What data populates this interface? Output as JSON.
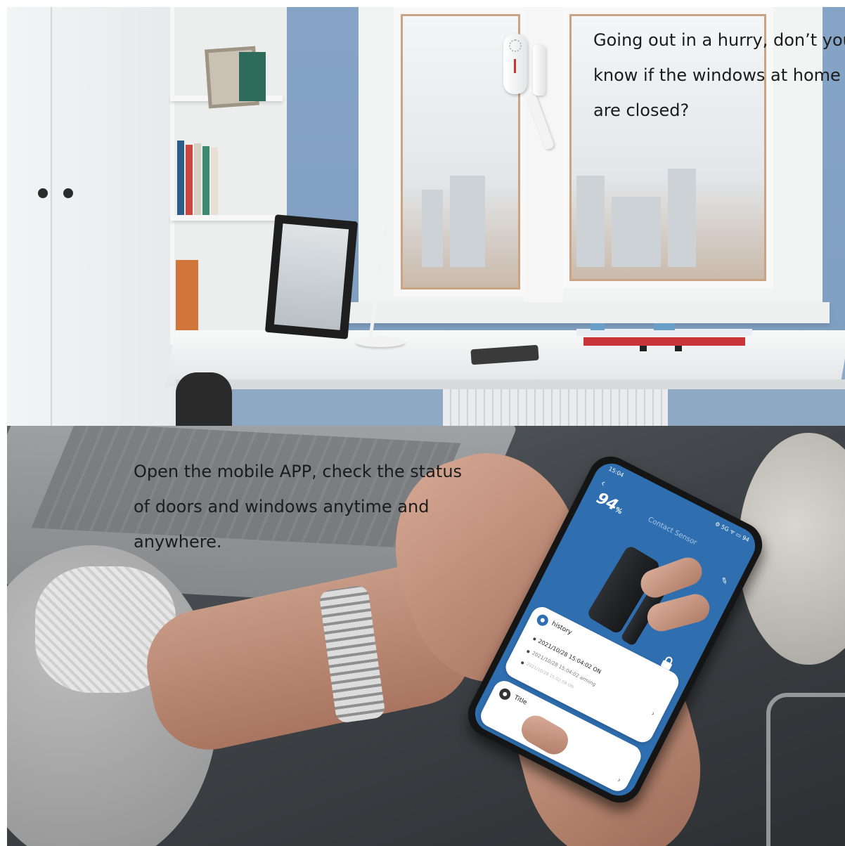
{
  "top_caption": {
    "lines": [
      "Going out in a hurry, don’t you",
      "know if the windows at home",
      "are closed?"
    ]
  },
  "bottom_caption": {
    "lines": [
      "Open the mobile APP, check the status",
      "of doors and windows anytime and",
      "anywhere."
    ]
  },
  "phone_app": {
    "status_time": "15:04",
    "status_icons": "⚙ 5G ᯤ ▭ 94",
    "battery_value": "94",
    "battery_unit": "%",
    "title": "Contact Sensor",
    "history_label": "history",
    "history_entries": [
      "2021/10/28 15:04:02 ON",
      "2021/10/28 15:04:02 arming",
      "2021/10/28 15:02:59 ON"
    ],
    "title_card_label": "Title"
  },
  "colors": {
    "app_blue": "#2f6fb0",
    "caption_text": "#1c1c1c"
  }
}
